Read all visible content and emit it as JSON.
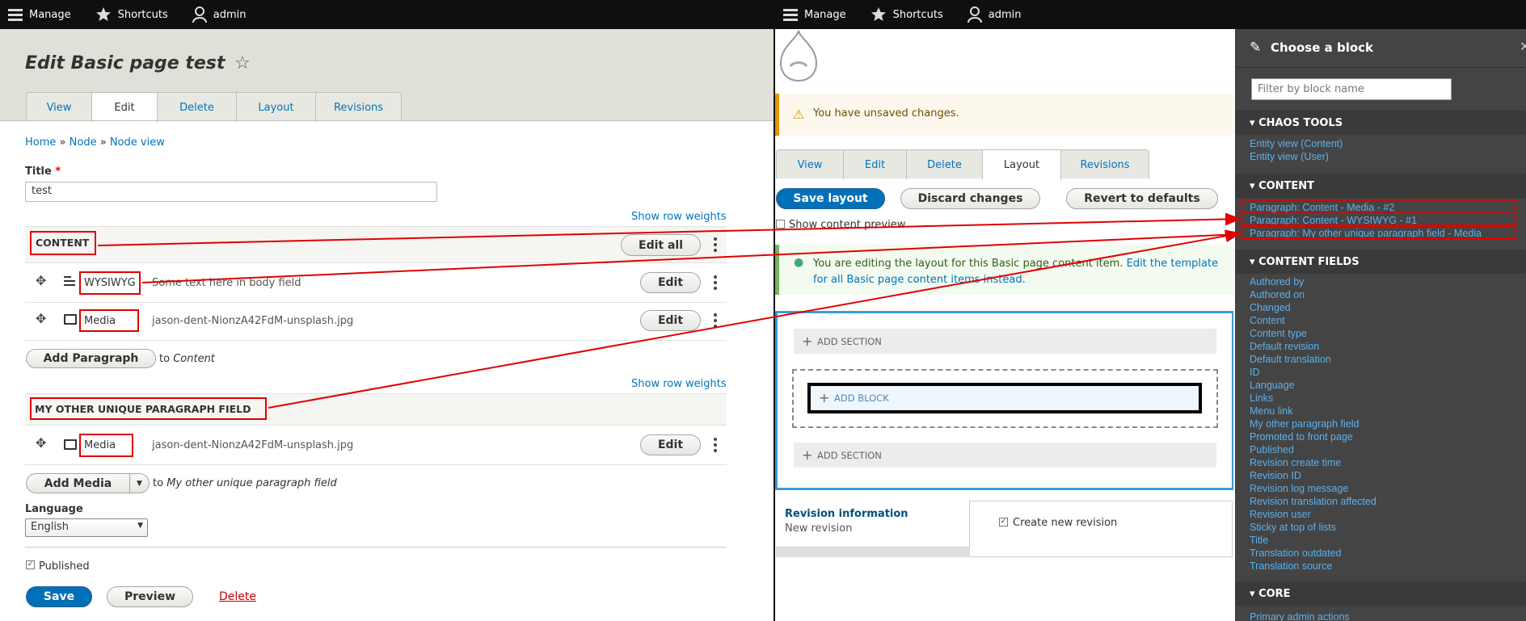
{
  "toolbar": {
    "manage": "Manage",
    "shortcuts": "Shortcuts",
    "admin": "admin"
  },
  "left": {
    "page_title": "Edit Basic page test",
    "tabs": [
      "View",
      "Edit",
      "Delete",
      "Layout",
      "Revisions"
    ],
    "breadcrumb": [
      "Home",
      "»",
      "Node",
      "»",
      "Node view"
    ],
    "title_label": "Title",
    "title_required": "*",
    "title_value": "test",
    "show_row_weights": "Show row weights",
    "content_section": "CONTENT",
    "edit_all": "Edit all",
    "rows": [
      {
        "type": "WYSIWYG",
        "summary": "Some text here in body field",
        "edit": "Edit"
      },
      {
        "type": "Media",
        "summary": "jason-dent-NionzA42FdM-unsplash.jpg",
        "edit": "Edit"
      }
    ],
    "add_paragraph": "Add Paragraph",
    "to": "to",
    "content_target": "Content",
    "show_row_weights2": "Show row weights",
    "other_section": "MY OTHER UNIQUE PARAGRAPH FIELD",
    "other_row": {
      "type": "Media",
      "summary": "jason-dent-NionzA42FdM-unsplash.jpg",
      "edit": "Edit"
    },
    "add_media": "Add Media",
    "other_target": "My other unique paragraph field",
    "language_label": "Language",
    "language_value": "English",
    "published": "Published",
    "save": "Save",
    "preview": "Preview",
    "delete": "Delete"
  },
  "middle": {
    "warning": "You have unsaved changes.",
    "tabs": [
      "View",
      "Edit",
      "Delete",
      "Layout",
      "Revisions"
    ],
    "save_layout": "Save layout",
    "discard": "Discard changes",
    "revert": "Revert to defaults",
    "show_preview": "Show content preview",
    "info_text": "You are editing the layout for this Basic page content item.",
    "info_link": "Edit the template",
    "info_link2": "for all Basic page content items instead.",
    "add_section": "ADD SECTION",
    "add_block": "ADD BLOCK",
    "add_section2": "ADD SECTION",
    "revision_info": "Revision information",
    "new_revision": "New revision",
    "create_revision": "Create new revision"
  },
  "sidebar": {
    "title": "Choose a block",
    "filter_placeholder": "Filter by block name",
    "chaos_tools": "CHAOS TOOLS",
    "chaos_items": [
      "Entity view (Content)",
      "Entity view (User)"
    ],
    "content": "CONTENT",
    "content_items": [
      "Paragraph: Content - Media - #2",
      "Paragraph: Content - WYSIWYG - #1",
      "Paragraph: My other unique paragraph field - Media"
    ],
    "content_fields": "CONTENT FIELDS",
    "field_items": [
      "Authored by",
      "Authored on",
      "Changed",
      "Content",
      "Content type",
      "Default revision",
      "Default translation",
      "ID",
      "Language",
      "Links",
      "Menu link",
      "My other paragraph field",
      "Promoted to front page",
      "Published",
      "Revision create time",
      "Revision ID",
      "Revision log message",
      "Revision translation affected",
      "Revision user",
      "Sticky at top of lists",
      "Title",
      "Translation outdated",
      "Translation source"
    ],
    "core": "CORE",
    "core_items": [
      "Primary admin actions"
    ]
  },
  "colors": {
    "link": "#0074bd",
    "primary": "#0071b8",
    "annotation": "#e00000",
    "sidebar": "#444444"
  }
}
